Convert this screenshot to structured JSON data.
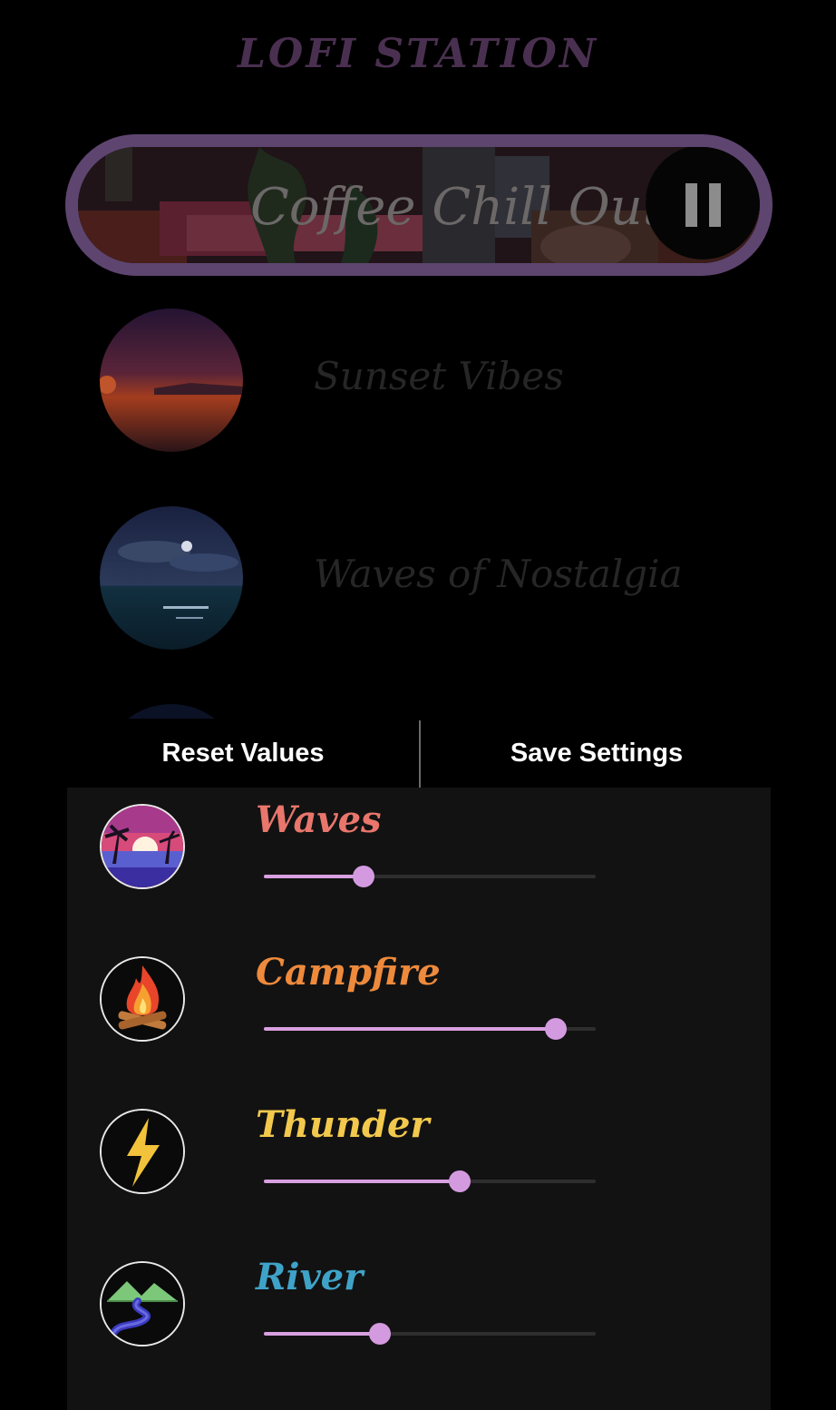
{
  "app": {
    "title": "LOFI STATION"
  },
  "now_playing": {
    "title": "Coffee Chill Out",
    "control": "pause-icon"
  },
  "tracks": [
    {
      "name": "Sunset Vibes"
    },
    {
      "name": "Waves of Nostalgia"
    }
  ],
  "actions": {
    "reset_label": "Reset Values",
    "save_label": "Save Settings"
  },
  "sounds": [
    {
      "name": "Waves",
      "color": "#e8766c",
      "icon": "beach-sunset-icon",
      "value_percent": 30
    },
    {
      "name": "Campfire",
      "color": "#ee8a3c",
      "icon": "campfire-icon",
      "value_percent": 88
    },
    {
      "name": "Thunder",
      "color": "#f2c94c",
      "icon": "lightning-icon",
      "value_percent": 59
    },
    {
      "name": "River",
      "color": "#3fa3c8",
      "icon": "river-icon",
      "value_percent": 35
    }
  ],
  "colors": {
    "accent": "#d49ae0",
    "border": "#5e4570"
  }
}
